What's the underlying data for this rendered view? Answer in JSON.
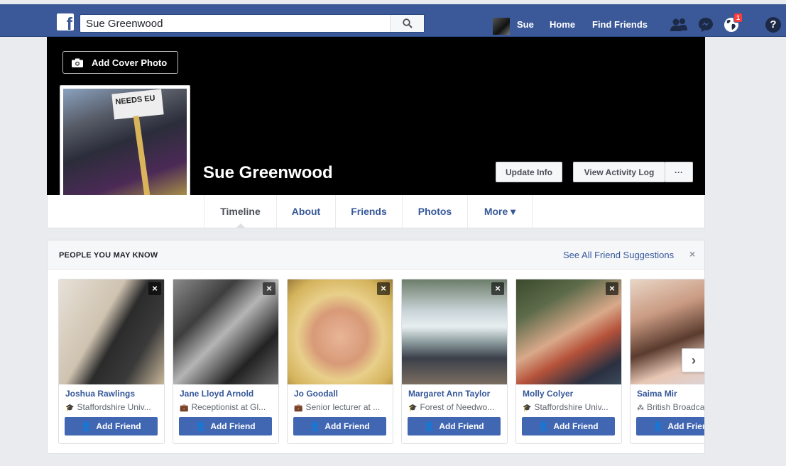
{
  "topbar": {
    "logo": "f",
    "search_value": "Sue Greenwood",
    "nav_user": "Sue",
    "nav_home": "Home",
    "nav_find_friends": "Find Friends",
    "notification_count": "1",
    "help": "?"
  },
  "profile": {
    "add_cover_label": "Add Cover Photo",
    "name": "Sue Greenwood",
    "placard_text": "NEEDS EU",
    "update_info": "Update Info",
    "view_activity_log": "View Activity Log",
    "more_options": "···"
  },
  "tabs": [
    {
      "label": "Timeline"
    },
    {
      "label": "About"
    },
    {
      "label": "Friends"
    },
    {
      "label": "Photos"
    },
    {
      "label": "More ▾"
    }
  ],
  "pymk": {
    "title": "PEOPLE YOU MAY KNOW",
    "see_all": "See All Friend Suggestions",
    "close": "×",
    "add_friend_label": "Add Friend",
    "next": "›",
    "people": [
      {
        "name": "Joshua Rawlings",
        "detail": "Staffordshire Univ...",
        "icon": "school-icon"
      },
      {
        "name": "Jane Lloyd Arnold",
        "detail": "Receptionist at Gl...",
        "icon": "work-icon"
      },
      {
        "name": "Jo Goodall",
        "detail": "Senior lecturer at ...",
        "icon": "work-icon"
      },
      {
        "name": "Margaret Ann Taylor",
        "detail": "Forest of Needwo...",
        "icon": "school-icon"
      },
      {
        "name": "Molly Colyer",
        "detail": "Staffordshire Univ...",
        "icon": "school-icon"
      },
      {
        "name": "Saima Mir",
        "detail": "British Broadcasting",
        "icon": "network-icon"
      }
    ]
  },
  "colors": {
    "brand_blue": "#3b5998",
    "button_blue": "#4267b2",
    "link_blue": "#365899",
    "page_bg": "#e9ebee"
  }
}
